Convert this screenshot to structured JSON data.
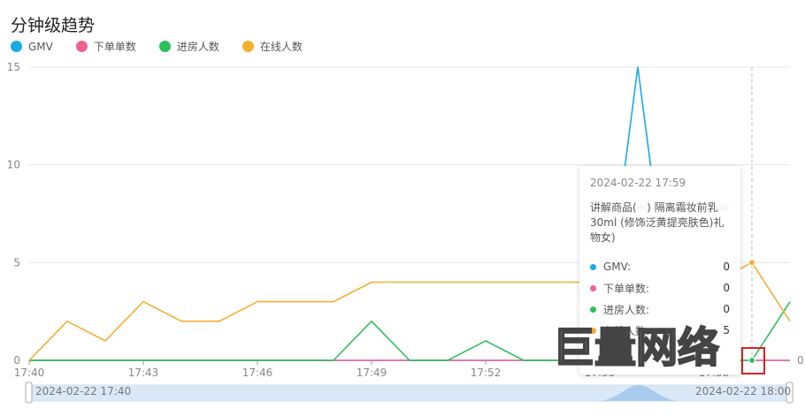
{
  "title": "分钟级趋势",
  "colors": {
    "gmv": "#1aaae3",
    "orders": "#f06292",
    "entries": "#2ec05a",
    "online": "#f4ae31"
  },
  "chart_data": {
    "type": "line",
    "x": [
      "17:40",
      "17:41",
      "17:42",
      "17:43",
      "17:44",
      "17:45",
      "17:46",
      "17:47",
      "17:48",
      "17:49",
      "17:50",
      "17:51",
      "17:52",
      "17:53",
      "17:54",
      "17:55",
      "17:56",
      "17:57",
      "17:58",
      "17:59",
      "18:00"
    ],
    "xticks": [
      "17:40",
      "17:43",
      "17:46",
      "17:49",
      "17:52",
      "17:55",
      "17:58"
    ],
    "yticks": [
      0,
      5,
      10,
      15
    ],
    "right_axis_ticks": [
      0
    ],
    "ylim": [
      0,
      15
    ],
    "series": [
      {
        "name": "GMV",
        "key": "gmv",
        "values": [
          0,
          0,
          0,
          0,
          0,
          0,
          0,
          0,
          0,
          0,
          0,
          0,
          0,
          0,
          0,
          0,
          15,
          0,
          0,
          0,
          0
        ]
      },
      {
        "name": "下单单数",
        "key": "orders",
        "values": [
          0,
          0,
          0,
          0,
          0,
          0,
          0,
          0,
          0,
          0,
          0,
          0,
          0,
          0,
          0,
          0,
          0,
          0,
          0,
          0,
          0
        ]
      },
      {
        "name": "进房人数",
        "key": "entries",
        "values": [
          0,
          0,
          0,
          0,
          0,
          0,
          0,
          0,
          0,
          2,
          0,
          0,
          1,
          0,
          0,
          0,
          0,
          0,
          0,
          0,
          3
        ]
      },
      {
        "name": "在线人数",
        "key": "online",
        "values": [
          0,
          2,
          1,
          3,
          2,
          2,
          3,
          3,
          3,
          4,
          4,
          4,
          4,
          4,
          4,
          4,
          4,
          4,
          4,
          5,
          2
        ]
      }
    ],
    "highlight_index": 19,
    "grid": true,
    "legend": "top-left"
  },
  "tooltip": {
    "time": "2024-02-22 17:59",
    "product_prefix": "讲解商品(",
    "product_blurred": "···",
    "product_mid": ")  隔离霜妆前乳",
    "product_blurred2": "···",
    "product_suffix": "30ml (修饰泛黄提亮肤色)礼物女)",
    "rows": [
      {
        "name": "GMV:",
        "value": "0"
      },
      {
        "name": "下单单数:",
        "value": "0"
      },
      {
        "name": "进房人数:",
        "value": "0"
      },
      {
        "name": "在线人数:",
        "value": "5"
      }
    ]
  },
  "slider": {
    "start_label": "2024-02-22 17:40",
    "end_label": "2024-02-22 18:00"
  },
  "watermark": "巨量网络"
}
